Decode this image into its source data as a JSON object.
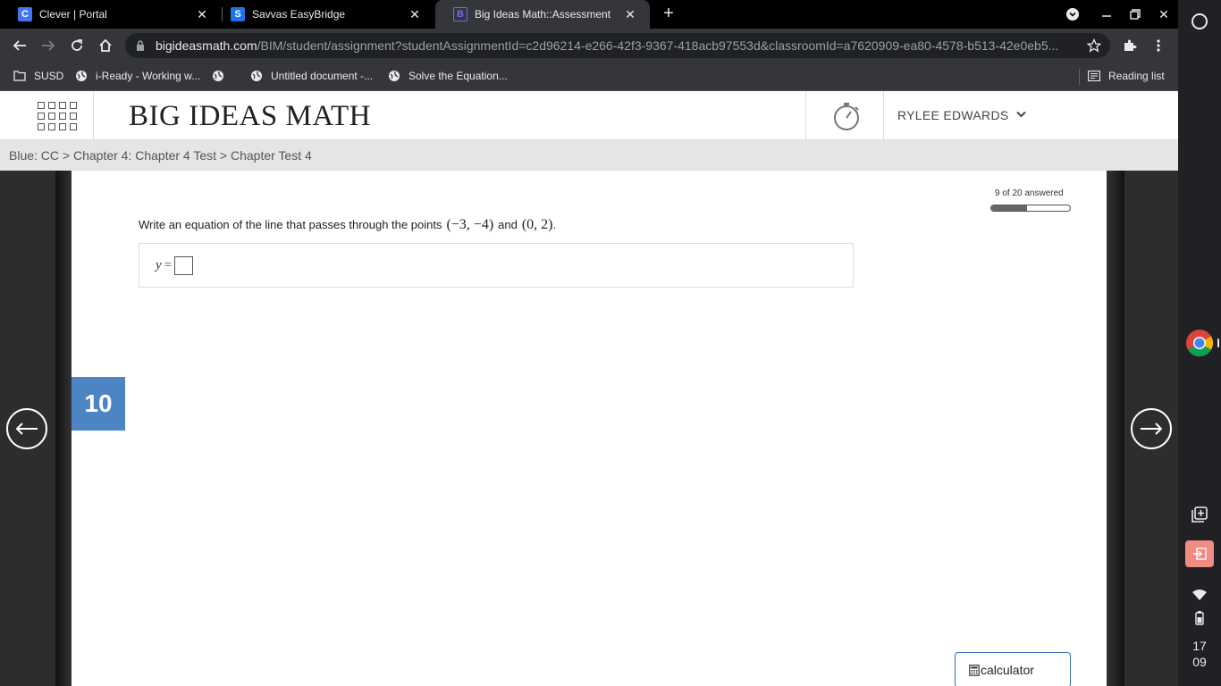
{
  "tabs": [
    {
      "title": "Clever | Portal",
      "favicon": "C",
      "favicon_color": "#4274f6"
    },
    {
      "title": "Savvas EasyBridge",
      "favicon": "S",
      "favicon_color": "#1a73e8"
    },
    {
      "title": "Big Ideas Math::Assessment",
      "favicon": "B",
      "favicon_color": "#35363a"
    }
  ],
  "toolbar": {
    "url_host": "bigideasmath.com",
    "url_path": "/BIM/student/assignment?studentAssignmentId=c2d96214-e266-42f3-9367-418acb97553d&classroomId=a7620909-ea80-4578-b513-42e0eb5..."
  },
  "bookmarks": [
    {
      "label": "SUSD",
      "icon": "folder-icon"
    },
    {
      "label": "i-Ready - Working w...",
      "icon": "globe-icon"
    },
    {
      "label": "",
      "icon": "globe-icon"
    },
    {
      "label": "Untitled document -...",
      "icon": "globe-icon"
    },
    {
      "label": "Solve the Equation...",
      "icon": "globe-icon"
    }
  ],
  "reading_list": "Reading list",
  "header": {
    "logo": "BIG IDEAS MATH",
    "user": "RYLEE EDWARDS"
  },
  "breadcrumb": "Blue: CC > Chapter 4: Chapter 4 Test > Chapter Test 4",
  "progress": {
    "label": "9 of 20 answered",
    "answered": 9,
    "total": 20
  },
  "question": {
    "number": "10",
    "text": "Write an equation of the line that passes through the points",
    "point1": "(−3, −4)",
    "conj": "and",
    "point2": "(0, 2)",
    "end": ".",
    "answer_var": "y",
    "answer_eq": "=",
    "answer_value": ""
  },
  "calculator_label": "calculator",
  "clock": {
    "hour": "17",
    "minute": "09"
  }
}
